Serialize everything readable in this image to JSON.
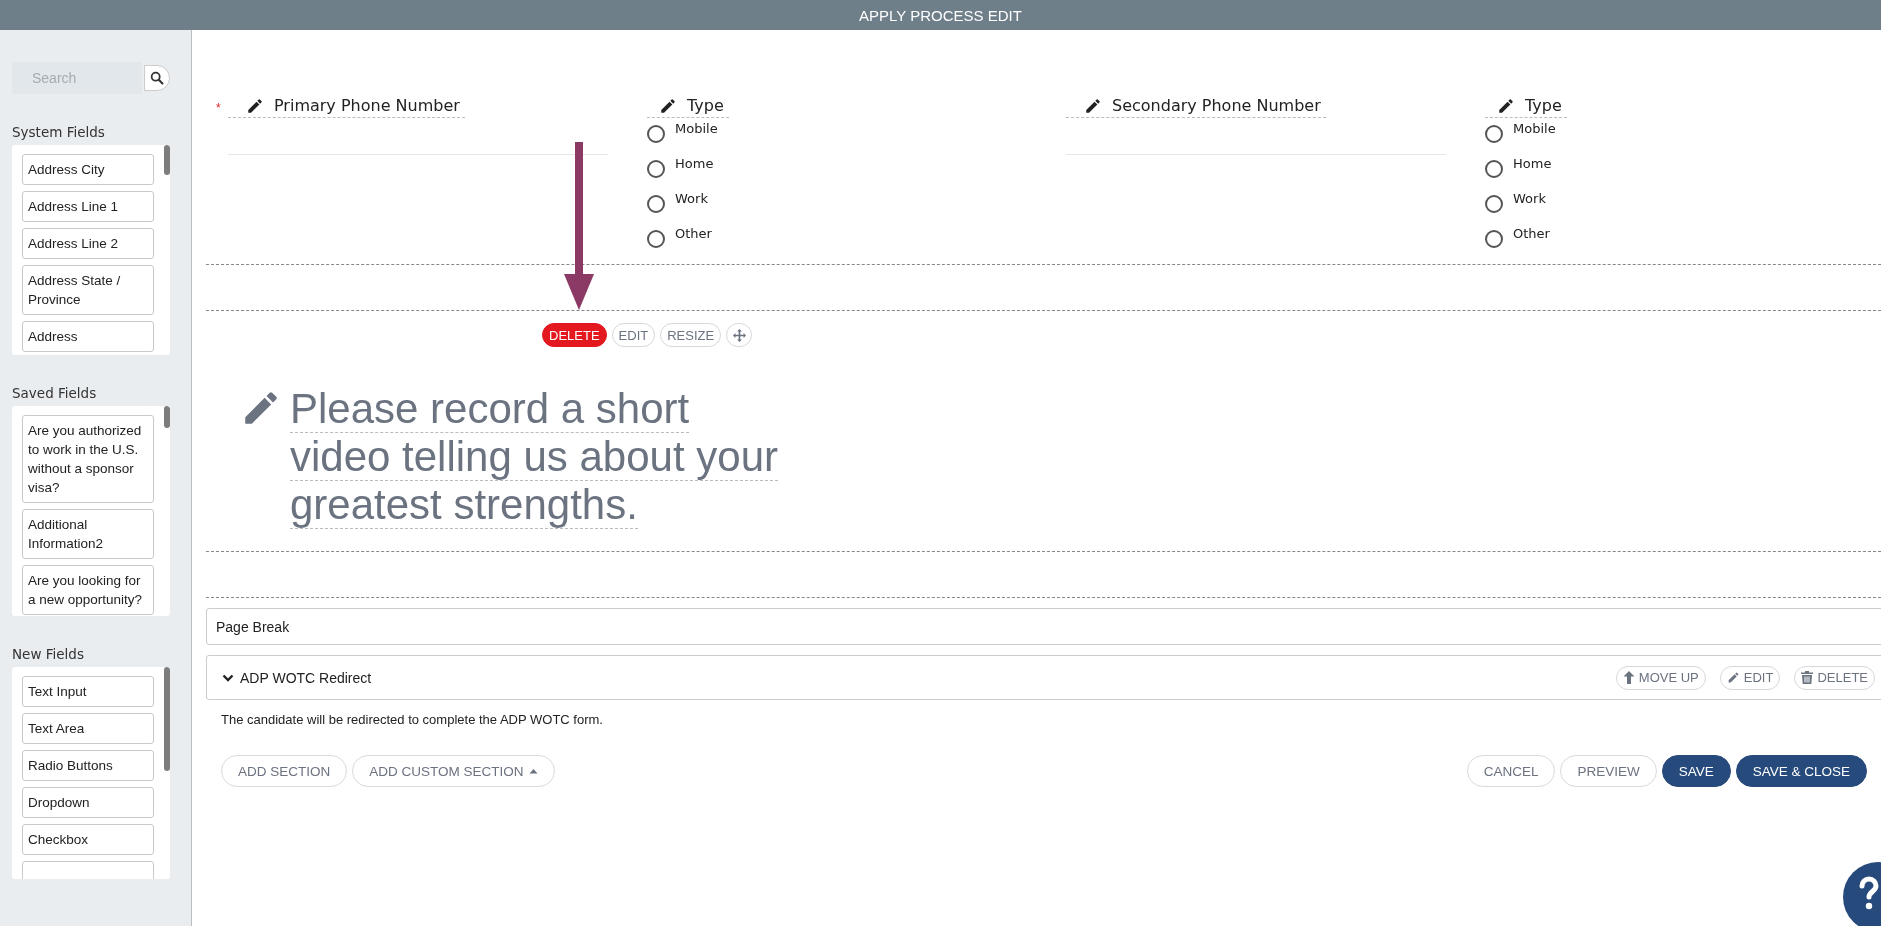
{
  "header": {
    "title": "APPLY PROCESS EDIT"
  },
  "sidebar": {
    "search": {
      "placeholder": "Search"
    },
    "groups": [
      {
        "title": "System Fields",
        "items": [
          "Address City",
          "Address Line 1",
          "Address Line 2",
          "Address State / Province",
          "Address"
        ]
      },
      {
        "title": "Saved Fields",
        "items": [
          "Are you authorized to work in the U.S. without a sponsor visa?",
          "Additional Information2",
          "Are you looking for a new opportunity?"
        ]
      },
      {
        "title": "New Fields",
        "items": [
          "Text Input",
          "Text Area",
          "Radio Buttons",
          "Dropdown",
          "Checkbox"
        ],
        "more_below": true
      }
    ]
  },
  "form": {
    "fields": [
      {
        "kind": "text",
        "label": "Primary Phone Number",
        "required_marker": "*"
      },
      {
        "kind": "radio",
        "label": "Type",
        "options": [
          {
            "label": "Mobile",
            "selected": false
          },
          {
            "label": "Home",
            "selected": false
          },
          {
            "label": "Work",
            "selected": false
          },
          {
            "label": "Other",
            "selected": false
          }
        ]
      },
      {
        "kind": "text",
        "label": "Secondary Phone Number"
      },
      {
        "kind": "radio",
        "label": "Type",
        "options": [
          {
            "label": "Mobile",
            "selected": false
          },
          {
            "label": "Home",
            "selected": false
          },
          {
            "label": "Work",
            "selected": false
          },
          {
            "label": "Other",
            "selected": false
          }
        ]
      }
    ],
    "element_toolbar": [
      {
        "kind": "danger",
        "label": "DELETE"
      },
      {
        "kind": "plain",
        "label": "EDIT"
      },
      {
        "kind": "plain",
        "label": "RESIZE"
      },
      {
        "kind": "move"
      }
    ],
    "prompt": "Please record a short video telling us about your greatest strengths.",
    "page_break": "Page Break",
    "section": {
      "title": "ADP WOTC Redirect",
      "expanded": true,
      "actions": [
        {
          "kind": "up",
          "label": "MOVE UP"
        },
        {
          "kind": "pencil",
          "label": "EDIT"
        },
        {
          "kind": "trash",
          "label": "DELETE"
        }
      ],
      "description": "The candidate will be redirected to complete the ADP WOTC form."
    }
  },
  "footer": {
    "left": [
      {
        "label": "ADD SECTION",
        "dropdown": false
      },
      {
        "label": "ADD CUSTOM SECTION",
        "dropdown": true
      }
    ],
    "right": [
      {
        "label": "CANCEL",
        "primary": false
      },
      {
        "label": "PREVIEW",
        "primary": false
      },
      {
        "label": "SAVE",
        "primary": true
      },
      {
        "label": "SAVE & CLOSE",
        "primary": true
      }
    ]
  }
}
